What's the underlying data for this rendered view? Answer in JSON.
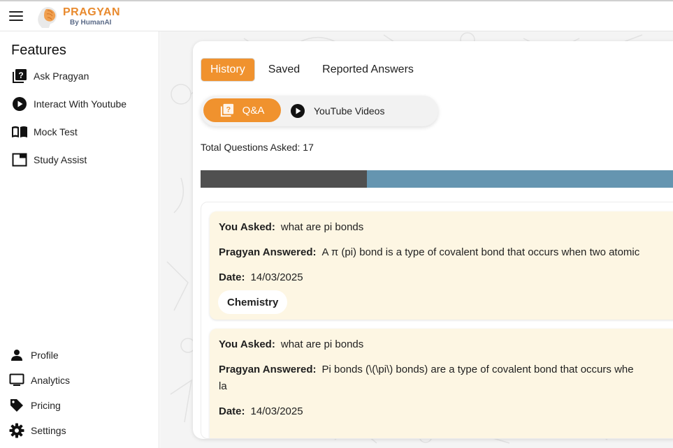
{
  "brand": {
    "title": "PRAGYAN",
    "subtitle": "By HumanAI"
  },
  "sidebar": {
    "heading": "Features",
    "items": [
      {
        "label": "Ask Pragyan",
        "icon": "question-box-icon"
      },
      {
        "label": "Interact With Youtube",
        "icon": "play-circle-icon"
      },
      {
        "label": "Mock Test",
        "icon": "open-book-icon"
      },
      {
        "label": "Study Assist",
        "icon": "window-icon"
      }
    ],
    "bottom_items": [
      {
        "label": "Profile",
        "icon": "person-icon"
      },
      {
        "label": "Analytics",
        "icon": "monitor-icon"
      },
      {
        "label": "Pricing",
        "icon": "tag-icon"
      },
      {
        "label": "Settings",
        "icon": "gear-icon"
      }
    ]
  },
  "tabs": [
    {
      "label": "History",
      "active": true
    },
    {
      "label": "Saved",
      "active": false
    },
    {
      "label": "Reported Answers",
      "active": false
    }
  ],
  "segment": {
    "qa_label": "Q&A",
    "youtube_label": "YouTube Videos"
  },
  "summary": {
    "total_text": "Total Questions Asked: 17"
  },
  "colors": {
    "accent": "#f0922e",
    "progress_dark": "#505050",
    "progress_light": "#6595b0",
    "card_bg": "#fdf6e3"
  },
  "history": [
    {
      "asked_label": "You Asked:",
      "question": "what are pi bonds",
      "answered_label": "Pragyan Answered:",
      "answer": "A π (pi) bond is a type of covalent bond that occurs when two atomic",
      "answer_line2": "",
      "date_label": "Date:",
      "date": "14/03/2025",
      "subject": "Chemistry"
    },
    {
      "asked_label": "You Asked:",
      "question": "what are pi bonds",
      "answered_label": "Pragyan Answered:",
      "answer": "Pi bonds (\\(\\pi\\) bonds) are a type of covalent bond that occurs whe",
      "answer_line2": "la",
      "date_label": "Date:",
      "date": "14/03/2025",
      "subject": ""
    }
  ]
}
